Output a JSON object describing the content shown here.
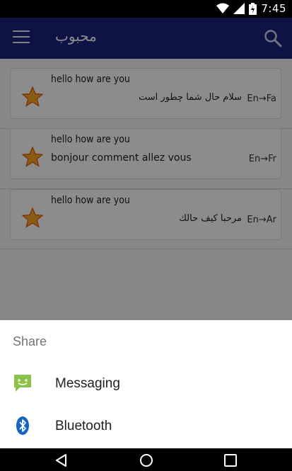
{
  "status_bar": {
    "time": "7:45"
  },
  "toolbar": {
    "title": "محبوب"
  },
  "translations": [
    {
      "source": "hello how are you",
      "target": "سلام حال شما چطور است",
      "lang": "En→Fa",
      "rtl": true
    },
    {
      "source": "hello how are you",
      "target": "bonjour comment allez vous",
      "lang": "En→Fr",
      "rtl": false
    },
    {
      "source": "hello how are you",
      "target": "مرحبا كيف حالك",
      "lang": "En→Ar",
      "rtl": true
    }
  ],
  "share_sheet": {
    "title": "Share",
    "items": [
      {
        "label": "Messaging",
        "icon": "messaging-icon"
      },
      {
        "label": "Bluetooth",
        "icon": "bluetooth-icon"
      }
    ]
  },
  "colors": {
    "toolbar": "#1a237e",
    "star": "#f9a825",
    "messaging": "#8bc34a",
    "bluetooth": "#1565c0"
  }
}
